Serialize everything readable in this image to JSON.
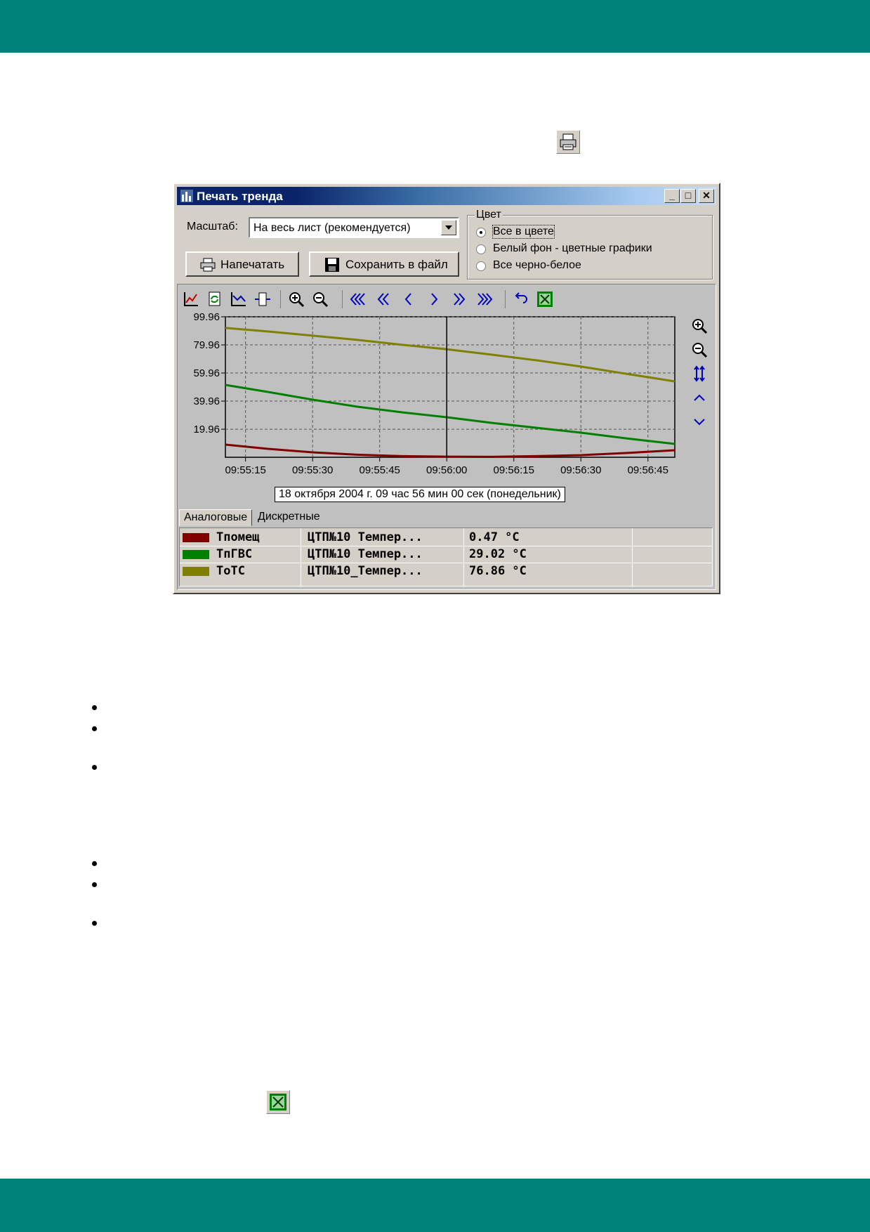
{
  "dialog": {
    "title": "Печать тренда",
    "window_buttons": {
      "minimize": "_",
      "maximize": "□",
      "close": "✕"
    },
    "scale_label": "Масштаб:",
    "scale_value": "На весь лист (рекомендуется)",
    "print_button": "Напечатать",
    "save_button": "Сохранить в файл",
    "color_group": {
      "label": "Цвет",
      "options": [
        "Все в цвете",
        "Белый фон - цветные графики",
        "Все черно-белое"
      ],
      "selected": 0
    },
    "timestamp": "18 октября 2004 г. 09 час 56 мин 00 сек (понедельник)",
    "tabs": [
      "Аналоговые",
      "Дискретные"
    ],
    "legend": [
      {
        "name": "Tпомещ",
        "source": "ЦТП№10 Темпер...",
        "value": "0.47 °C",
        "color": "#800000"
      },
      {
        "name": "TпГВС",
        "source": "ЦТП№10 Темпер...",
        "value": "29.02 °C",
        "color": "#008000"
      },
      {
        "name": "ToTC",
        "source": "ЦТП№10_Темпер...",
        "value": "76.86 °C",
        "color": "#808000"
      }
    ]
  },
  "chart_data": {
    "type": "line",
    "ylim": [
      0,
      99.96
    ],
    "yticks": [
      "99.96",
      "79.96",
      "59.96",
      "39.96",
      "19.96"
    ],
    "ytick_values": [
      99.96,
      79.96,
      59.96,
      39.96,
      19.96
    ],
    "xticks": [
      "09:55:15",
      "09:55:30",
      "09:55:45",
      "09:56:00",
      "09:56:15",
      "09:56:30",
      "09:56:45"
    ],
    "xtick_seconds": [
      15,
      30,
      45,
      60,
      75,
      90,
      105
    ],
    "xlim_seconds": [
      10.5,
      111
    ],
    "cursor_seconds": 60,
    "grid": true,
    "series": [
      {
        "name": "Tпомещ",
        "color": "#800000",
        "x": [
          10.5,
          20,
          30,
          40,
          50,
          60,
          70,
          80,
          90,
          100,
          111
        ],
        "y": [
          9.0,
          6.0,
          3.5,
          1.8,
          0.8,
          0.47,
          0.3,
          0.8,
          1.5,
          3.0,
          5.0
        ]
      },
      {
        "name": "TпГВС",
        "color": "#008000",
        "x": [
          10.5,
          20,
          30,
          40,
          50,
          60,
          70,
          80,
          90,
          100,
          111
        ],
        "y": [
          51.5,
          46.5,
          41.0,
          36.0,
          32.0,
          28.5,
          24.5,
          21.0,
          17.5,
          13.5,
          9.5
        ]
      },
      {
        "name": "ToTC",
        "color": "#808000",
        "x": [
          10.5,
          20,
          30,
          40,
          50,
          60,
          70,
          80,
          90,
          100,
          111
        ],
        "y": [
          92.0,
          89.5,
          86.5,
          83.5,
          80.0,
          76.86,
          73.0,
          69.0,
          64.5,
          59.5,
          54.0
        ]
      }
    ]
  }
}
